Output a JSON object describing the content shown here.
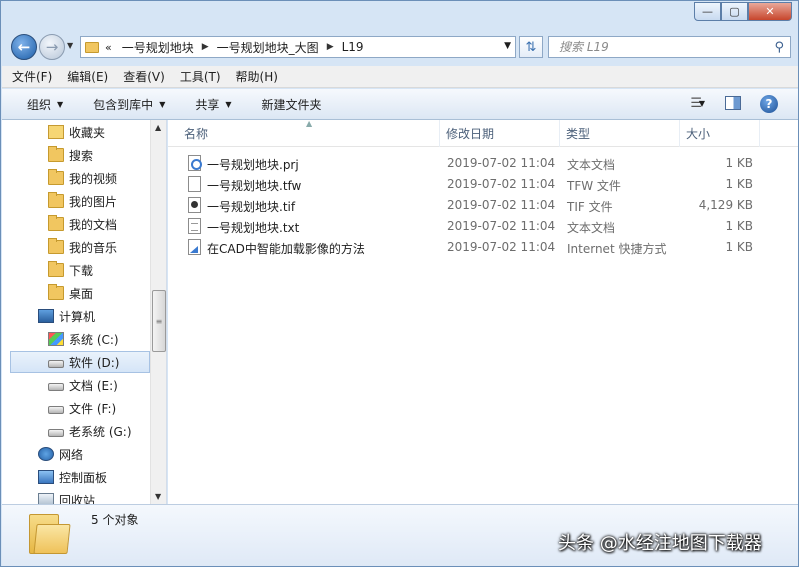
{
  "window": {
    "minimize_glyph": "—",
    "maximize_glyph": "▢",
    "close_glyph": "✕"
  },
  "address": {
    "lead": "«",
    "crumbs": [
      "一号规划地块",
      "一号规划地块_大图",
      "L19"
    ]
  },
  "search": {
    "placeholder": "搜索 L19"
  },
  "menu": [
    "文件(F)",
    "编辑(E)",
    "查看(V)",
    "工具(T)",
    "帮助(H)"
  ],
  "toolbar": {
    "organize": "组织",
    "include_in_library": "包含到库中",
    "share": "共享",
    "new_folder": "新建文件夹"
  },
  "nav": [
    {
      "label": "收藏夹",
      "icon": "favorites-icon"
    },
    {
      "label": "搜索",
      "icon": "folder-icon"
    },
    {
      "label": "我的视频",
      "icon": "folder-icon"
    },
    {
      "label": "我的图片",
      "icon": "folder-icon"
    },
    {
      "label": "我的文档",
      "icon": "folder-icon"
    },
    {
      "label": "我的音乐",
      "icon": "folder-icon"
    },
    {
      "label": "下载",
      "icon": "folder-icon"
    },
    {
      "label": "桌面",
      "icon": "folder-icon"
    },
    {
      "label": "计算机",
      "icon": "computer-icon"
    },
    {
      "label": "系统 (C:)",
      "icon": "system-drive-icon"
    },
    {
      "label": "软件 (D:)",
      "icon": "drive-icon"
    },
    {
      "label": "文档 (E:)",
      "icon": "drive-icon"
    },
    {
      "label": "文件 (F:)",
      "icon": "drive-icon"
    },
    {
      "label": "老系统 (G:)",
      "icon": "drive-icon"
    },
    {
      "label": "网络",
      "icon": "network-icon"
    },
    {
      "label": "控制面板",
      "icon": "control-panel-icon"
    },
    {
      "label": "回收站",
      "icon": "recycle-bin-icon"
    }
  ],
  "columns": {
    "name": "名称",
    "modified": "修改日期",
    "type": "类型",
    "size": "大小"
  },
  "files": [
    {
      "name": "一号规划地块.prj",
      "modified": "2019-07-02 11:04",
      "type": "文本文档",
      "size": "1 KB",
      "icon": "prj"
    },
    {
      "name": "一号规划地块.tfw",
      "modified": "2019-07-02 11:04",
      "type": "TFW 文件",
      "size": "1 KB",
      "icon": "tfw"
    },
    {
      "name": "一号规划地块.tif",
      "modified": "2019-07-02 11:04",
      "type": "TIF 文件",
      "size": "4,129 KB",
      "icon": "tif"
    },
    {
      "name": "一号规划地块.txt",
      "modified": "2019-07-02 11:04",
      "type": "文本文档",
      "size": "1 KB",
      "icon": "txt"
    },
    {
      "name": "在CAD中智能加载影像的方法",
      "modified": "2019-07-02 11:04",
      "type": "Internet 快捷方式",
      "size": "1 KB",
      "icon": "url"
    }
  ],
  "status": {
    "count": "5 个对象"
  },
  "watermark": "头条 @水经注地图下载器"
}
